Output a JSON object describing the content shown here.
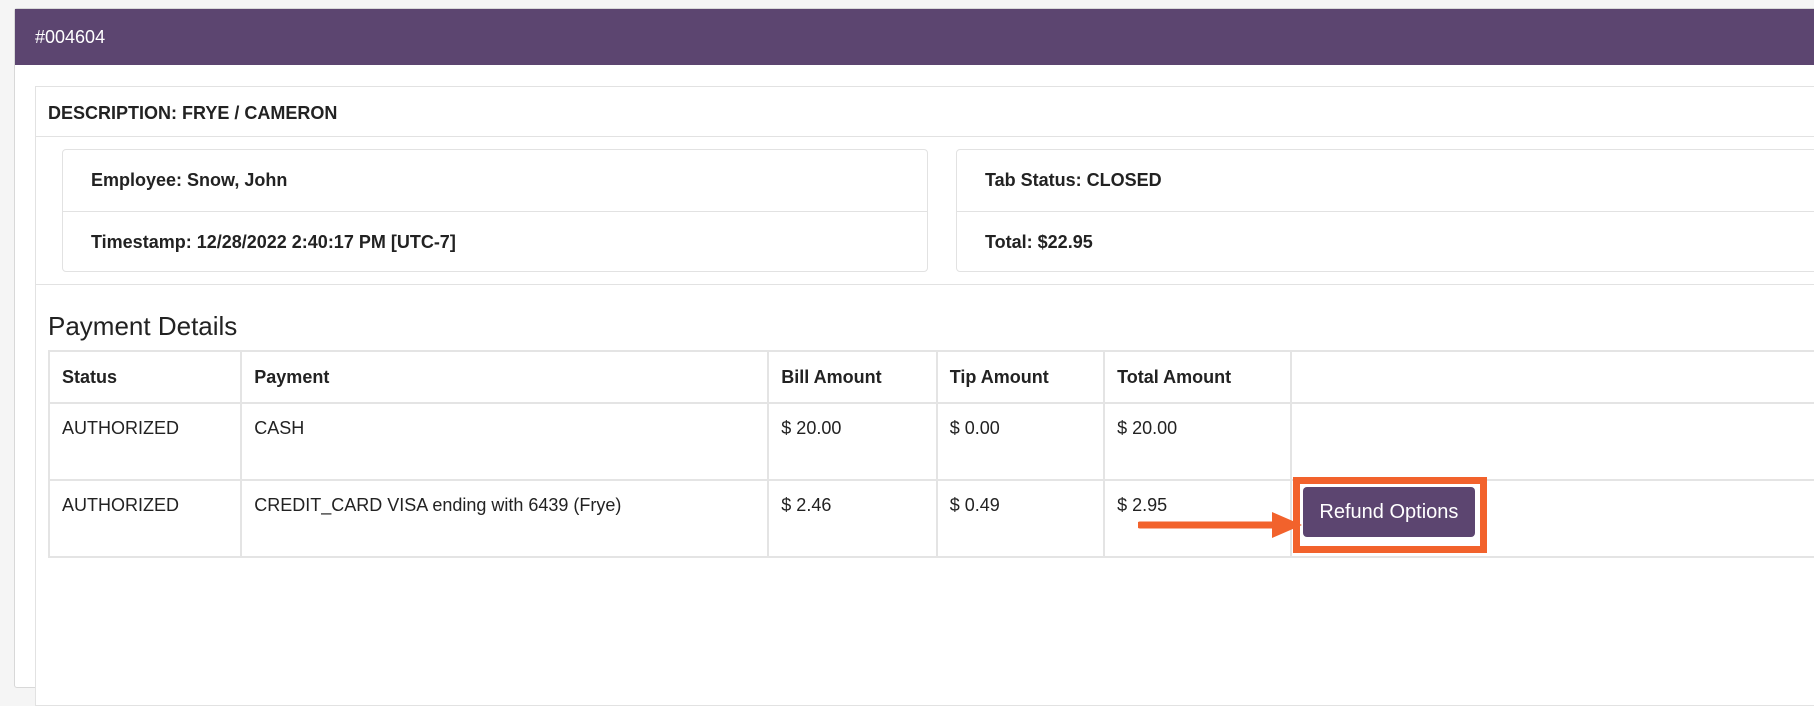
{
  "header": {
    "order_number": "#004604"
  },
  "description": {
    "text": "DESCRIPTION: FRYE / CAMERON"
  },
  "info": {
    "employee": "Employee: Snow, John",
    "timestamp": "Timestamp: 12/28/2022 2:40:17 PM [UTC-7]",
    "tab_status": "Tab Status: CLOSED",
    "total": "Total: $22.95"
  },
  "payment_details": {
    "title": "Payment Details",
    "columns": [
      "Status",
      "Payment",
      "Bill Amount",
      "Tip Amount",
      "Total Amount",
      ""
    ],
    "rows": [
      {
        "status": "AUTHORIZED",
        "payment": "CASH",
        "bill": "$ 20.00",
        "tip": "$ 0.00",
        "total": "$ 20.00"
      },
      {
        "status": "AUTHORIZED",
        "payment": "CREDIT_CARD VISA ending with 6439 (Frye)",
        "bill": "$ 2.46",
        "tip": "$ 0.49",
        "total": "$ 2.95"
      }
    ],
    "refund_button_label": "Refund Options"
  },
  "colors": {
    "header_bg": "#5c4570",
    "button_bg": "#5c4570",
    "highlight": "#f2622c"
  }
}
